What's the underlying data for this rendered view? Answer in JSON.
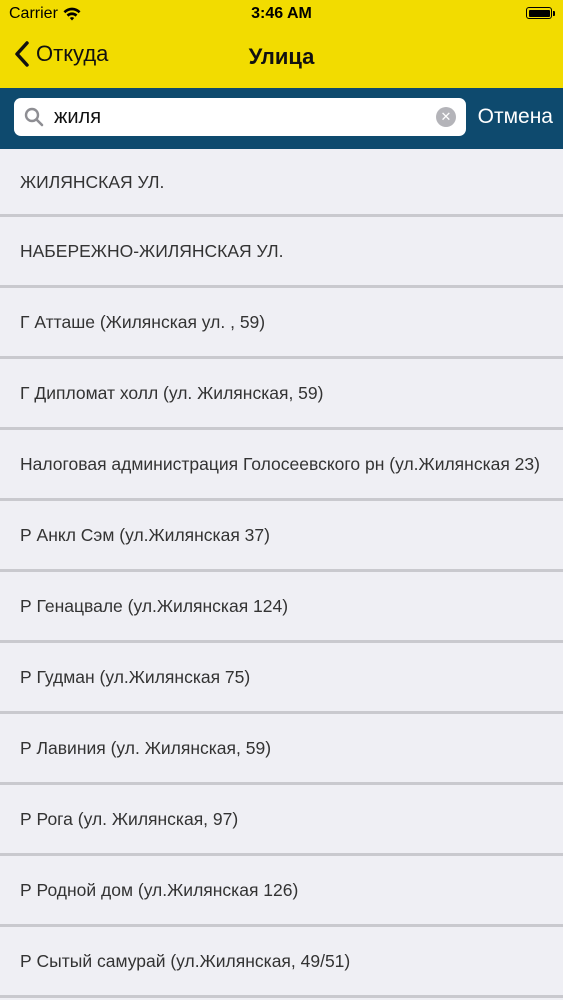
{
  "status": {
    "carrier": "Carrier",
    "time": "3:46 AM"
  },
  "nav": {
    "back_label": "Откуда",
    "title": "Улица"
  },
  "search": {
    "value": "жиля",
    "cancel_label": "Отмена"
  },
  "colors": {
    "topbar": "#f2dc00",
    "searchbar": "#0e4a6e"
  },
  "results": [
    "ЖИЛЯНСКАЯ УЛ.",
    "НАБЕРЕЖНО-ЖИЛЯНСКАЯ УЛ.",
    "Г Атташе (Жилянская ул. , 59)",
    "Г Дипломат холл (ул. Жилянская, 59)",
    "Налоговая администрация Голосеевского рн (ул.Жилянская 23)",
    "Р Анкл Сэм (ул.Жилянская 37)",
    "Р Генацвале (ул.Жилянская 124)",
    "Р Гудман (ул.Жилянская 75)",
    "Р Лавиния (ул. Жилянская, 59)",
    "Р Рога (ул. Жилянская, 97)",
    "Р Родной дом (ул.Жилянская 126)",
    "Р Сытый самурай (ул.Жилянская, 49/51)"
  ]
}
